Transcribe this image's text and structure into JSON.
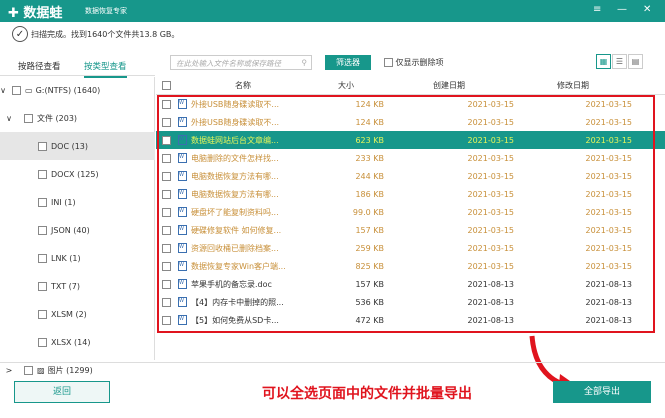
{
  "header": {
    "app_name": "数据蛙",
    "subtitle": "数据恢复专家",
    "menu": "≡",
    "minimize": "—",
    "close": "✕"
  },
  "status": "扫描完成。找到1640个文件共13.8 GB。",
  "tabs": [
    {
      "label": "按路径查看"
    },
    {
      "label": "按类型查看"
    }
  ],
  "search": {
    "placeholder": "在此处输入文件名称或保存路径"
  },
  "filter_label": "筛选器",
  "show_deleted_label": "仅显示删除项",
  "tree": [
    {
      "label": "G:(NTFS) (1640)",
      "arrow": "∨"
    },
    {
      "label": "文件 (203)",
      "arrow": "∨"
    },
    {
      "label": "DOC (13)"
    },
    {
      "label": "DOCX (125)"
    },
    {
      "label": "INI (1)"
    },
    {
      "label": "JSON (40)"
    },
    {
      "label": "LNK (1)"
    },
    {
      "label": "TXT (7)"
    },
    {
      "label": "XLSM (2)"
    },
    {
      "label": "XLSX (14)"
    },
    {
      "label": "图片 (1299)",
      "arrow": ">"
    }
  ],
  "columns": [
    "名称",
    "大小",
    "创建日期",
    "修改日期"
  ],
  "rows": [
    {
      "name": "外接USB随身碟读取不...",
      "size": "124 KB",
      "created": "2021-03-15",
      "modified": "2021-03-15",
      "deleted": true
    },
    {
      "name": "外接USB随身碟读取不...",
      "size": "124 KB",
      "created": "2021-03-15",
      "modified": "2021-03-15",
      "deleted": true
    },
    {
      "name": "数据蛙网站后台文章编...",
      "size": "623 KB",
      "created": "2021-03-15",
      "modified": "2021-03-15",
      "deleted": true,
      "selected": true
    },
    {
      "name": "电脑删除的文件怎样找...",
      "size": "233 KB",
      "created": "2021-03-15",
      "modified": "2021-03-15",
      "deleted": true
    },
    {
      "name": "电脑数据恢复方法有哪...",
      "size": "244 KB",
      "created": "2021-03-15",
      "modified": "2021-03-15",
      "deleted": true
    },
    {
      "name": "电脑数据恢复方法有哪...",
      "size": "186 KB",
      "created": "2021-03-15",
      "modified": "2021-03-15",
      "deleted": true
    },
    {
      "name": "硬盘坏了能复制资料吗...",
      "size": "99.0 KB",
      "created": "2021-03-15",
      "modified": "2021-03-15",
      "deleted": true
    },
    {
      "name": "硬碟修复软件 如何修复...",
      "size": "157 KB",
      "created": "2021-03-15",
      "modified": "2021-03-15",
      "deleted": true
    },
    {
      "name": "资源回收桶已删除档案...",
      "size": "259 KB",
      "created": "2021-03-15",
      "modified": "2021-03-15",
      "deleted": true
    },
    {
      "name": "数据恢复专家Win客户端...",
      "size": "825 KB",
      "created": "2021-03-15",
      "modified": "2021-03-15",
      "deleted": true
    },
    {
      "name": "苹果手机的备忘录.doc",
      "size": "157 KB",
      "created": "2021-08-13",
      "modified": "2021-08-13",
      "deleted": false
    },
    {
      "name": "【4】内存卡中删掉的照...",
      "size": "536 KB",
      "created": "2021-08-13",
      "modified": "2021-08-13",
      "deleted": false
    },
    {
      "name": "【5】如何免费从SD卡...",
      "size": "472 KB",
      "created": "2021-08-13",
      "modified": "2021-08-13",
      "deleted": false
    }
  ],
  "back_label": "返回",
  "export_label": "全部导出",
  "annotation": "可以全选页面中的文件并批量导出"
}
